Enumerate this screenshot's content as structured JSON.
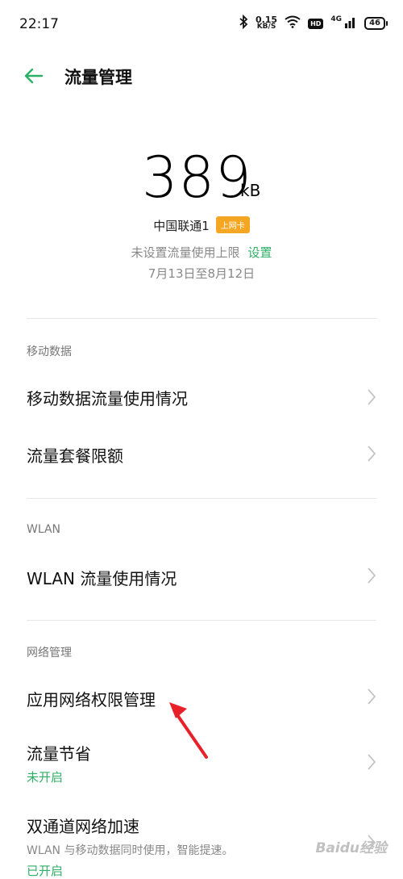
{
  "status_bar": {
    "time": "22:17",
    "speed_value": "0.15",
    "speed_unit": "KB/S",
    "hd_label": "HD",
    "network_type": "4G",
    "battery": "46"
  },
  "header": {
    "title": "流量管理"
  },
  "usage": {
    "value": "389",
    "unit": "kB",
    "sim_name": "中国联通1",
    "sim_badge": "上网卡",
    "limit_text": "未设置流量使用上限",
    "limit_link": "设置",
    "period": "7月13日至8月12日"
  },
  "sections": {
    "mobile": {
      "label": "移动数据",
      "items": [
        {
          "title": "移动数据流量使用情况"
        },
        {
          "title": "流量套餐限额"
        }
      ]
    },
    "wlan": {
      "label": "WLAN",
      "items": [
        {
          "title": "WLAN 流量使用情况"
        }
      ]
    },
    "network": {
      "label": "网络管理",
      "items": [
        {
          "title": "应用网络权限管理"
        },
        {
          "title": "流量节省",
          "status": "未开启"
        },
        {
          "title": "双通道网络加速",
          "desc": "WLAN 与移动数据同时使用，智能提速。",
          "status": "已开启"
        }
      ]
    }
  },
  "watermark": "Baidu经验",
  "colors": {
    "accent": "#2eaf66",
    "badge": "#f5a623",
    "annotation": "#e8202a"
  }
}
